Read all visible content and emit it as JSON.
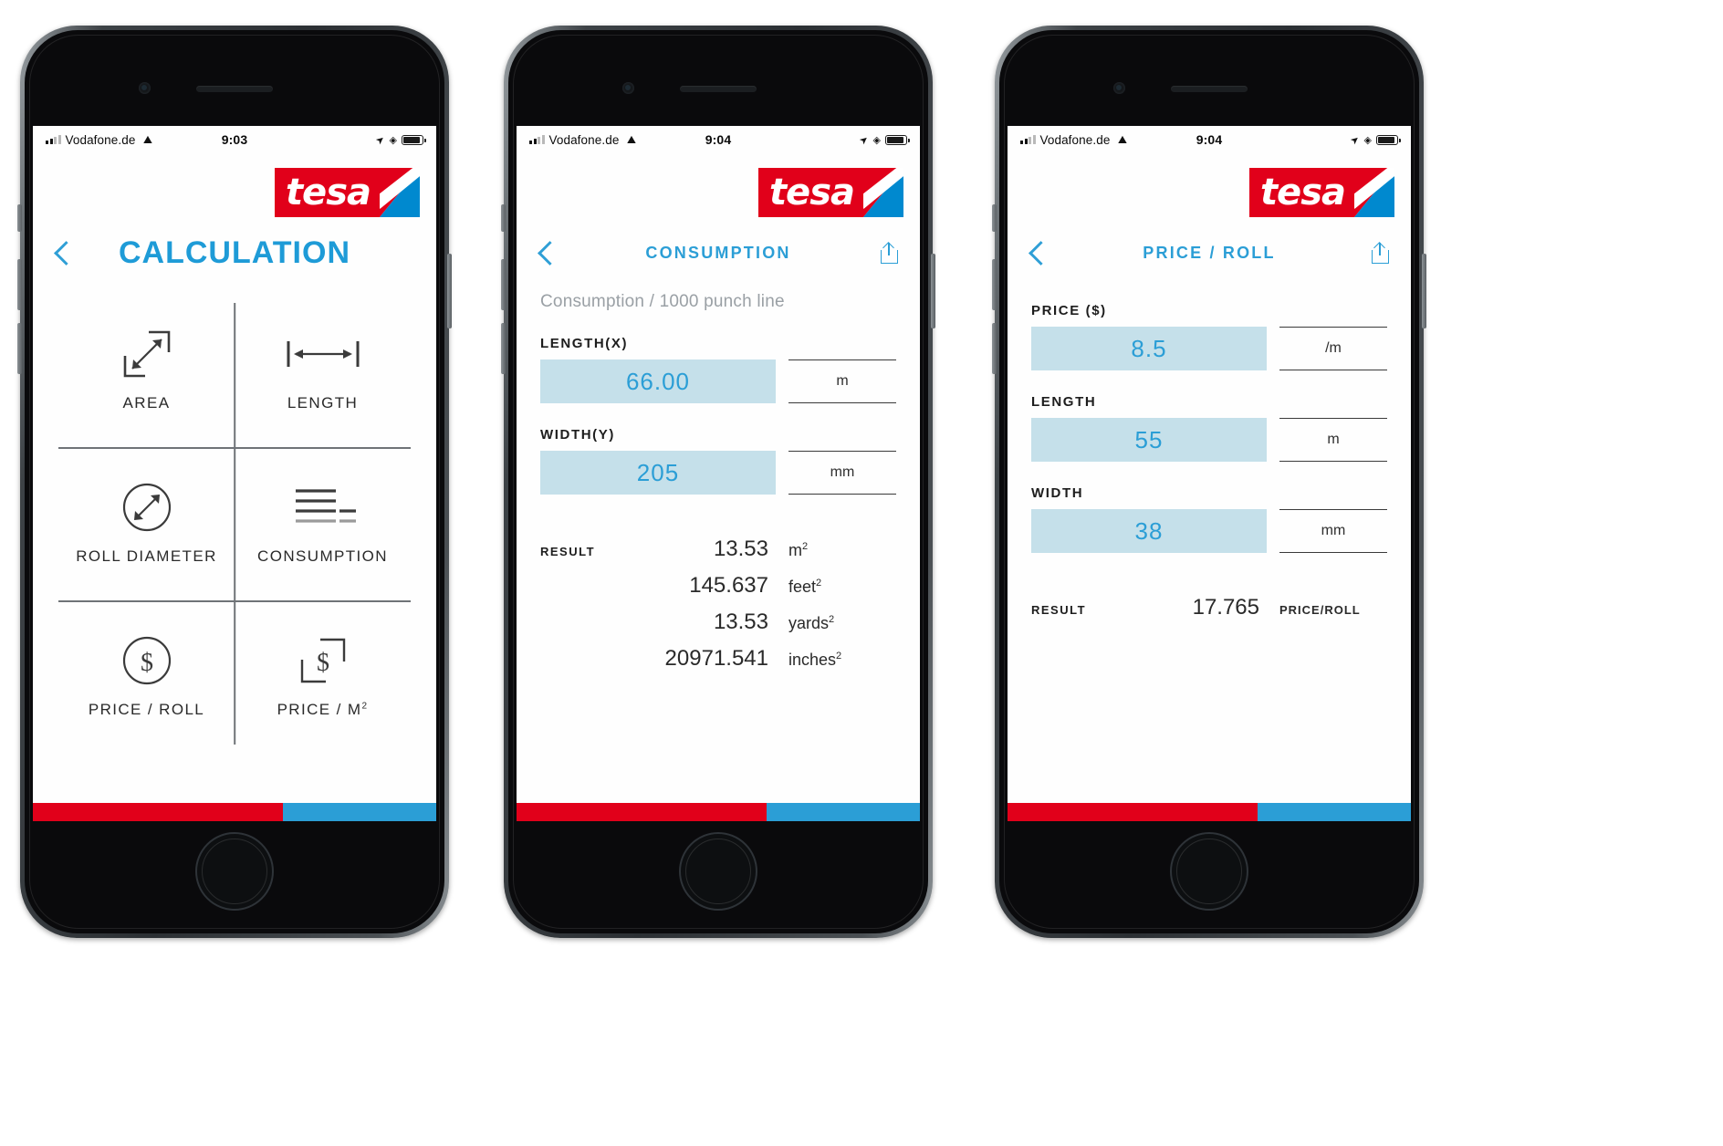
{
  "brand": {
    "name": "tesa",
    "red": "#e1001a",
    "blue": "#2b9ed6",
    "accent_text": "#2b9ed6",
    "field_fill": "#c5e0ea"
  },
  "phones": [
    {
      "id": "calculation",
      "statusbar": {
        "carrier": "Vodafone.de",
        "signal_icon": "signal-bars-icon",
        "wifi_icon": "wifi-icon",
        "time": "9:03",
        "location_icon": "location-arrow-icon",
        "bluetooth_icon": "bluetooth-icon",
        "battery_icon": "battery-icon"
      },
      "nav": {
        "back_icon": "back-chevron-icon",
        "title": "CALCULATION",
        "share_icon": null
      },
      "grid": [
        {
          "label": "AREA",
          "icon": "diagonal-arrow-area-icon"
        },
        {
          "label": "LENGTH",
          "icon": "horizontal-arrow-length-icon"
        },
        {
          "label": "ROLL DIAMETER",
          "icon": "circle-diameter-icon"
        },
        {
          "label": "CONSUMPTION",
          "icon": "stacked-lines-consumption-icon"
        },
        {
          "label": "PRICE / ROLL",
          "icon": "dollar-circle-icon"
        },
        {
          "label": "PRICE / M",
          "label_sup": "2",
          "icon": "dollar-square-icon"
        }
      ]
    },
    {
      "id": "consumption",
      "statusbar": {
        "carrier": "Vodafone.de",
        "signal_icon": "signal-bars-icon",
        "wifi_icon": "wifi-icon",
        "time": "9:04",
        "location_icon": "location-arrow-icon",
        "bluetooth_icon": "bluetooth-icon",
        "battery_icon": "battery-icon"
      },
      "nav": {
        "back_icon": "back-chevron-icon",
        "title": "CONSUMPTION",
        "share_icon": "share-icon"
      },
      "subtitle": "Consumption / 1000 punch line",
      "fields": [
        {
          "label": "LENGTH(X)",
          "value": "66.00",
          "unit": "m"
        },
        {
          "label": "WIDTH(Y)",
          "value": "205",
          "unit": "mm"
        }
      ],
      "result": {
        "label": "RESULT",
        "rows": [
          {
            "value": "13.53",
            "unit": "m",
            "unit_sup": "2"
          },
          {
            "value": "145.637",
            "unit": "feet",
            "unit_sup": "2"
          },
          {
            "value": "13.53",
            "unit": "yards",
            "unit_sup": "2"
          },
          {
            "value": "20971.541",
            "unit": "inches",
            "unit_sup": "2"
          }
        ]
      }
    },
    {
      "id": "price-per-roll",
      "statusbar": {
        "carrier": "Vodafone.de",
        "signal_icon": "signal-bars-icon",
        "wifi_icon": "wifi-icon",
        "time": "9:04",
        "location_icon": "location-arrow-icon",
        "bluetooth_icon": "bluetooth-icon",
        "battery_icon": "battery-icon"
      },
      "nav": {
        "back_icon": "back-chevron-icon",
        "title": "PRICE / ROLL",
        "share_icon": "share-icon"
      },
      "subtitle": "",
      "fields": [
        {
          "label": "PRICE ($)",
          "value": "8.5",
          "unit": "/m"
        },
        {
          "label": "LENGTH",
          "value": "55",
          "unit": "m"
        },
        {
          "label": "WIDTH",
          "value": "38",
          "unit": "mm"
        }
      ],
      "result": {
        "label": "RESULT",
        "rows": [
          {
            "value": "17.765",
            "unit": "PRICE/ROLL",
            "unit_sup": ""
          }
        ]
      }
    }
  ]
}
